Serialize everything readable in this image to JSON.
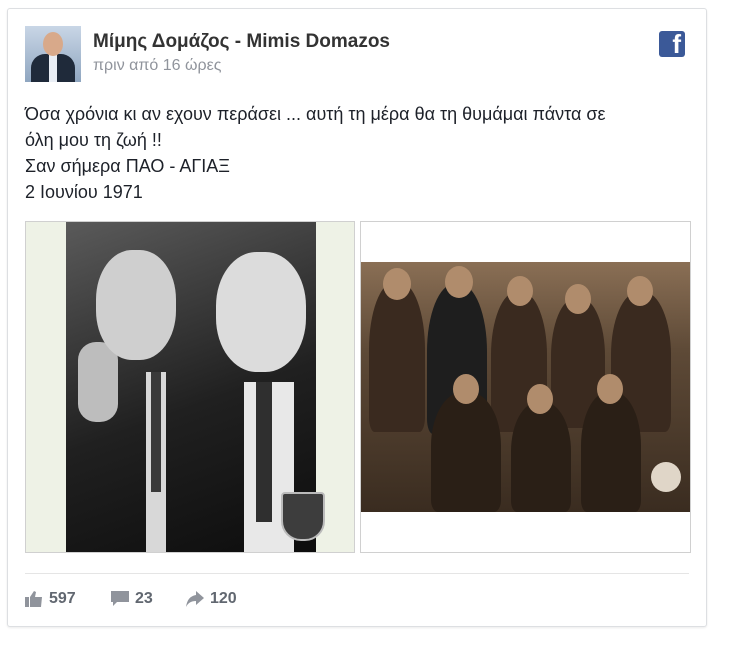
{
  "post": {
    "author": "Μίμης Δομάζος - Mimis Domazos",
    "time": "πριν από 16 ώρες",
    "lines": [
      "Όσα χρόνια κι αν εχουν περάσει ... αυτή τη μέρα θα τη θυμάμαι πάντα σε",
      "όλη μου τη ζωή !!",
      "Σαν σήμερα ΠΑΟ - ΑΓΙΑΞ",
      "2 Ιουνίου 1971"
    ]
  },
  "stats": {
    "likes": "597",
    "comments": "23",
    "shares": "120"
  },
  "icons": {
    "brand": "facebook-icon",
    "like": "thumbs-up-icon",
    "comment": "comment-bubble-icon",
    "share": "share-arrow-icon"
  },
  "colors": {
    "brand": "#3b5998",
    "stat_text": "#616770",
    "time_text": "#90949c"
  }
}
